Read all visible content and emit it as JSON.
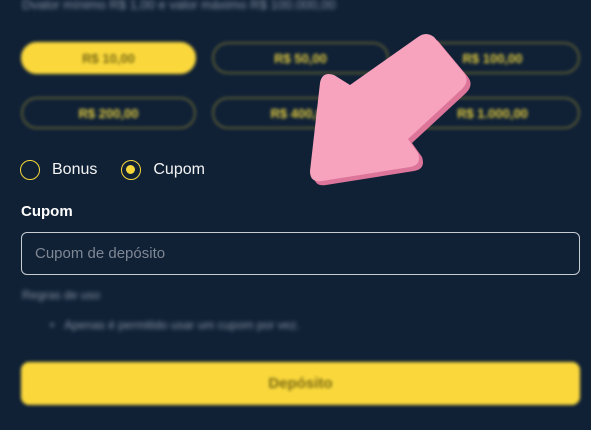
{
  "deposit_limits_text": "Dvalor mínimo R$ 1,00 e valor máximo R$ 100.000,00",
  "amounts": [
    {
      "label": "R$ 10,00",
      "active": true
    },
    {
      "label": "R$ 50,00",
      "active": false
    },
    {
      "label": "R$ 100,00",
      "active": false
    },
    {
      "label": "R$ 200,00",
      "active": false
    },
    {
      "label": "R$ 400,00",
      "active": false
    },
    {
      "label": "R$ 1.000,00",
      "active": false
    }
  ],
  "type_options": [
    {
      "label": "Bonus",
      "checked": false
    },
    {
      "label": "Cupom",
      "checked": true
    }
  ],
  "coupon": {
    "label": "Cupom",
    "placeholder": "Cupom de depósito",
    "value": ""
  },
  "rules": {
    "title": "Regras de uso",
    "items": [
      "Apenas é permitido usar um cupom por vez."
    ]
  },
  "deposit_button": "Depósito",
  "colors": {
    "background": "#102136",
    "accent": "#fad83c",
    "arrow": "#f48fb1"
  },
  "annotation_icon": "arrow-down-left-icon"
}
